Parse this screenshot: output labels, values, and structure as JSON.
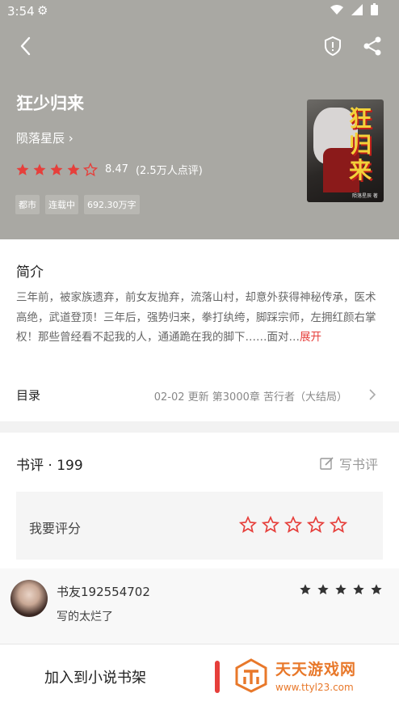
{
  "status": {
    "time": "3:54"
  },
  "book": {
    "title": "狂少归来",
    "author": "陨落星辰",
    "score": "8.47",
    "rating_count": "(2.5万人点评)",
    "rating_stars": 4.5,
    "tags": [
      "都市",
      "连载中",
      "692.30万字"
    ],
    "cover_title": "狂少归来"
  },
  "intro": {
    "heading": "简介",
    "text": "三年前，被家族遗弃，前女友抛弃，流落山村，却意外获得神秘传承，医术高绝，武道登顶！三年后，强势归来，拳打纨绔，脚踩宗师，左拥红颜右掌权！那些曾经看不起我的人，通通跪在我的脚下……面对…",
    "expand": "展开"
  },
  "toc": {
    "label": "目录",
    "info": "02-02  更新  第3000章 苦行者（大结局）"
  },
  "reviews": {
    "heading": "书评 · 199",
    "write_label": "写书评",
    "rate_label": "我要评分",
    "comment": {
      "user": "书友192554702",
      "text": "写的太烂了"
    }
  },
  "bottom": {
    "add_shelf": "加入到小说书架",
    "watermark_name": "天天游戏网",
    "watermark_url": "www.ttyl23.com"
  },
  "colors": {
    "accent": "#e63f3b",
    "header_bg": "#a9a8a3",
    "watermark": "#e8782a"
  }
}
